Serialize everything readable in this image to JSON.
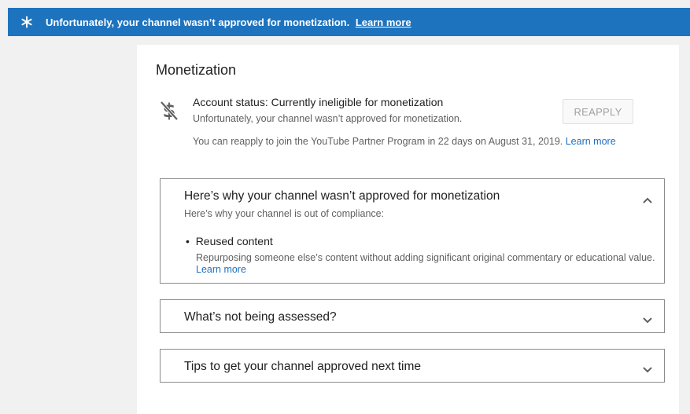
{
  "banner": {
    "message": "Unfortunately, your channel wasn’t approved for monetization.",
    "link": "Learn more"
  },
  "card": {
    "title": "Monetization",
    "status": {
      "icon": "no-monetization-icon",
      "main": "Account status: Currently ineligible for monetization",
      "sub": "Unfortunately, your channel wasn’t approved for monetization.",
      "reapply_label": "REAPPLY",
      "reapply_note": "You can reapply to join the YouTube Partner Program in 22 days on August 31, 2019.",
      "reapply_link": "Learn more"
    },
    "panels": [
      {
        "title": "Here’s why your channel wasn’t approved for monetization",
        "subtitle": "Here’s why your channel is out of compliance:",
        "expanded": true,
        "reasons": [
          {
            "title": "Reused content",
            "description": "Repurposing someone else’s content without adding significant original commentary or educational value.",
            "link": "Learn more"
          }
        ]
      },
      {
        "title": "What’s not being assessed?",
        "expanded": false
      },
      {
        "title": "Tips to get your channel approved next time",
        "expanded": false
      }
    ]
  },
  "colors": {
    "banner_bg": "#1e73be",
    "link": "#1e6fbf",
    "panel_border": "#8a8a8a"
  }
}
